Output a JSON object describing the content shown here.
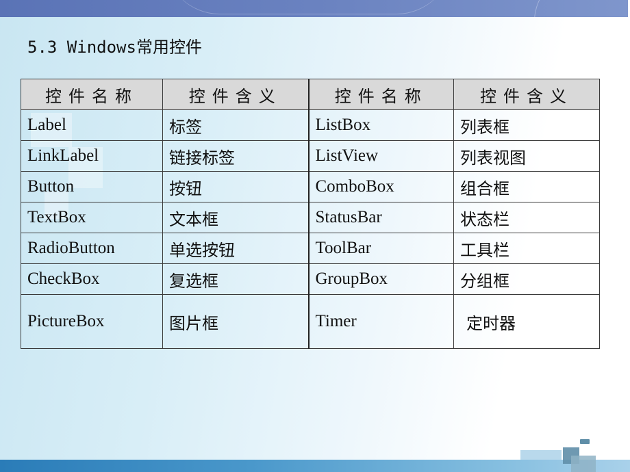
{
  "slide": {
    "title": "5.3  Windows常用控件"
  },
  "table": {
    "headers": [
      "控件名称",
      "控件含义",
      "控件名称",
      "控件含义"
    ],
    "rows": [
      {
        "name1": "Label",
        "meaning1": "标签",
        "name2": "ListBox",
        "meaning2": "列表框"
      },
      {
        "name1": "LinkLabel",
        "meaning1": "链接标签",
        "name2": "ListView",
        "meaning2": "列表视图"
      },
      {
        "name1": "Button",
        "meaning1": "按钮",
        "name2": "ComboBox",
        "meaning2": "组合框"
      },
      {
        "name1": "TextBox",
        "meaning1": "文本框",
        "name2": "StatusBar",
        "meaning2": "状态栏"
      },
      {
        "name1": "RadioButton",
        "meaning1": "单选按钮",
        "name2": "ToolBar",
        "meaning2": "工具栏"
      },
      {
        "name1": "CheckBox",
        "meaning1": "复选框",
        "name2": "GroupBox",
        "meaning2": "分组框"
      },
      {
        "name1": "PictureBox",
        "meaning1": "图片框",
        "name2": "Timer",
        "meaning2": "定时器"
      }
    ]
  },
  "colors": {
    "top_band": "#6a82c0",
    "header_fill": "#d9d9d9",
    "bottom_band": "#2a7cb8",
    "deco_squares": "#5f8ea8"
  }
}
